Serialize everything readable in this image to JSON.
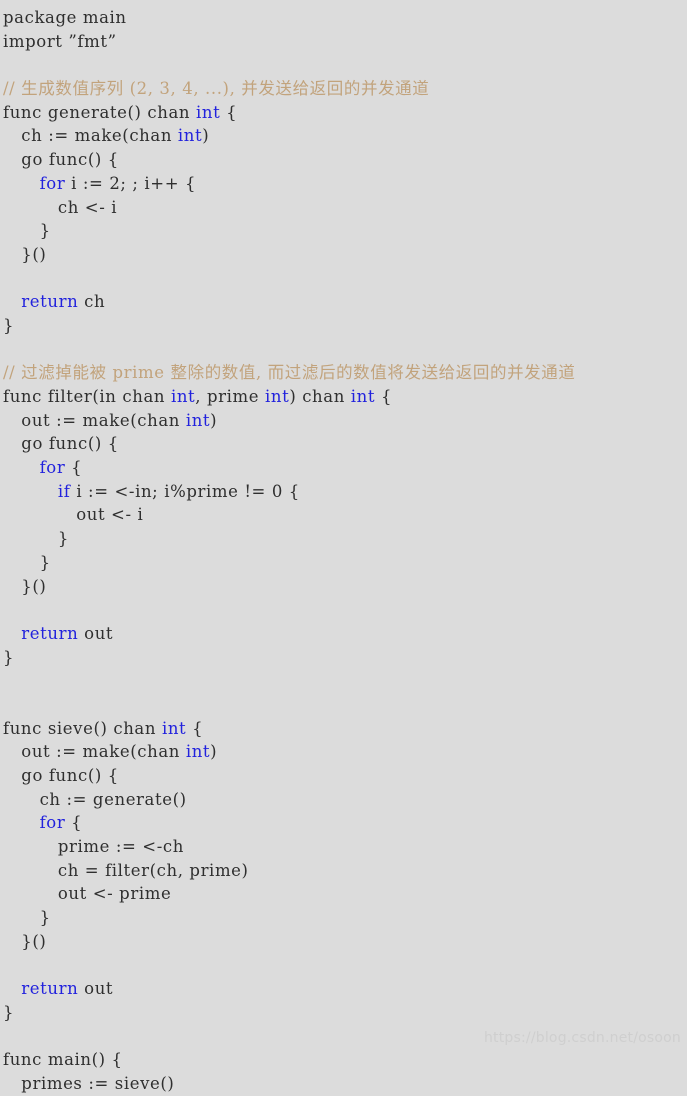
{
  "editor": {
    "language": "go",
    "background_color": "#dcdcdc",
    "text_color": "#2f2f2f",
    "keyword_color": "#2222dd",
    "comment_color": "#c2a37c",
    "watermark_color": "#cfcfcf"
  },
  "watermark": {
    "text": "https://blog.csdn.net/osoon"
  },
  "code": {
    "lines": [
      {
        "indent": 0,
        "tokens": [
          {
            "t": "plain",
            "s": "package main"
          }
        ]
      },
      {
        "indent": 0,
        "tokens": [
          {
            "t": "plain",
            "s": "import ”fmt”"
          }
        ]
      },
      {
        "indent": 0,
        "tokens": [
          {
            "t": "plain",
            "s": ""
          }
        ]
      },
      {
        "indent": 0,
        "tokens": [
          {
            "t": "comment",
            "s": "// 生成数值序列 (2, 3, 4, ...), 并发送给返回的并发通道"
          }
        ]
      },
      {
        "indent": 0,
        "tokens": [
          {
            "t": "plain",
            "s": "func generate() chan "
          },
          {
            "t": "kw",
            "s": "int"
          },
          {
            "t": "plain",
            "s": " {"
          }
        ]
      },
      {
        "indent": 1,
        "tokens": [
          {
            "t": "plain",
            "s": "ch := make(chan "
          },
          {
            "t": "kw",
            "s": "int"
          },
          {
            "t": "plain",
            "s": ")"
          }
        ]
      },
      {
        "indent": 1,
        "tokens": [
          {
            "t": "plain",
            "s": "go func() {"
          }
        ]
      },
      {
        "indent": 2,
        "tokens": [
          {
            "t": "kw",
            "s": "for"
          },
          {
            "t": "plain",
            "s": " i := 2; ; i++ {"
          }
        ]
      },
      {
        "indent": 3,
        "tokens": [
          {
            "t": "plain",
            "s": "ch <- i"
          }
        ]
      },
      {
        "indent": 2,
        "tokens": [
          {
            "t": "plain",
            "s": "}"
          }
        ]
      },
      {
        "indent": 1,
        "tokens": [
          {
            "t": "plain",
            "s": "}()"
          }
        ]
      },
      {
        "indent": 0,
        "tokens": [
          {
            "t": "plain",
            "s": ""
          }
        ]
      },
      {
        "indent": 1,
        "tokens": [
          {
            "t": "kw",
            "s": "return"
          },
          {
            "t": "plain",
            "s": " ch"
          }
        ]
      },
      {
        "indent": 0,
        "tokens": [
          {
            "t": "plain",
            "s": "}"
          }
        ]
      },
      {
        "indent": 0,
        "tokens": [
          {
            "t": "plain",
            "s": ""
          }
        ]
      },
      {
        "indent": 0,
        "tokens": [
          {
            "t": "comment",
            "s": "// 过滤掉能被 prime 整除的数值, 而过滤后的数值将发送给返回的并发通道"
          }
        ]
      },
      {
        "indent": 0,
        "tokens": [
          {
            "t": "plain",
            "s": "func filter(in chan "
          },
          {
            "t": "kw",
            "s": "int"
          },
          {
            "t": "plain",
            "s": ", prime "
          },
          {
            "t": "kw",
            "s": "int"
          },
          {
            "t": "plain",
            "s": ") chan "
          },
          {
            "t": "kw",
            "s": "int"
          },
          {
            "t": "plain",
            "s": " {"
          }
        ]
      },
      {
        "indent": 1,
        "tokens": [
          {
            "t": "plain",
            "s": "out := make(chan "
          },
          {
            "t": "kw",
            "s": "int"
          },
          {
            "t": "plain",
            "s": ")"
          }
        ]
      },
      {
        "indent": 1,
        "tokens": [
          {
            "t": "plain",
            "s": "go func() {"
          }
        ]
      },
      {
        "indent": 2,
        "tokens": [
          {
            "t": "kw",
            "s": "for"
          },
          {
            "t": "plain",
            "s": " {"
          }
        ]
      },
      {
        "indent": 3,
        "tokens": [
          {
            "t": "kw",
            "s": "if"
          },
          {
            "t": "plain",
            "s": " i := <-in; i%prime != 0 {"
          }
        ]
      },
      {
        "indent": 4,
        "tokens": [
          {
            "t": "plain",
            "s": "out <- i"
          }
        ]
      },
      {
        "indent": 3,
        "tokens": [
          {
            "t": "plain",
            "s": "}"
          }
        ]
      },
      {
        "indent": 2,
        "tokens": [
          {
            "t": "plain",
            "s": "}"
          }
        ]
      },
      {
        "indent": 1,
        "tokens": [
          {
            "t": "plain",
            "s": "}()"
          }
        ]
      },
      {
        "indent": 0,
        "tokens": [
          {
            "t": "plain",
            "s": ""
          }
        ]
      },
      {
        "indent": 1,
        "tokens": [
          {
            "t": "kw",
            "s": "return"
          },
          {
            "t": "plain",
            "s": " out"
          }
        ]
      },
      {
        "indent": 0,
        "tokens": [
          {
            "t": "plain",
            "s": "}"
          }
        ]
      },
      {
        "indent": 0,
        "tokens": [
          {
            "t": "plain",
            "s": ""
          }
        ]
      },
      {
        "indent": 0,
        "tokens": [
          {
            "t": "plain",
            "s": ""
          }
        ]
      },
      {
        "indent": 0,
        "tokens": [
          {
            "t": "plain",
            "s": "func sieve() chan "
          },
          {
            "t": "kw",
            "s": "int"
          },
          {
            "t": "plain",
            "s": " {"
          }
        ]
      },
      {
        "indent": 1,
        "tokens": [
          {
            "t": "plain",
            "s": "out := make(chan "
          },
          {
            "t": "kw",
            "s": "int"
          },
          {
            "t": "plain",
            "s": ")"
          }
        ]
      },
      {
        "indent": 1,
        "tokens": [
          {
            "t": "plain",
            "s": "go func() {"
          }
        ]
      },
      {
        "indent": 2,
        "tokens": [
          {
            "t": "plain",
            "s": "ch := generate()"
          }
        ]
      },
      {
        "indent": 2,
        "tokens": [
          {
            "t": "kw",
            "s": "for"
          },
          {
            "t": "plain",
            "s": " {"
          }
        ]
      },
      {
        "indent": 3,
        "tokens": [
          {
            "t": "plain",
            "s": "prime := <-ch"
          }
        ]
      },
      {
        "indent": 3,
        "tokens": [
          {
            "t": "plain",
            "s": "ch = filter(ch, prime)"
          }
        ]
      },
      {
        "indent": 3,
        "tokens": [
          {
            "t": "plain",
            "s": "out <- prime"
          }
        ]
      },
      {
        "indent": 2,
        "tokens": [
          {
            "t": "plain",
            "s": "}"
          }
        ]
      },
      {
        "indent": 1,
        "tokens": [
          {
            "t": "plain",
            "s": "}()"
          }
        ]
      },
      {
        "indent": 0,
        "tokens": [
          {
            "t": "plain",
            "s": ""
          }
        ]
      },
      {
        "indent": 1,
        "tokens": [
          {
            "t": "kw",
            "s": "return"
          },
          {
            "t": "plain",
            "s": " out"
          }
        ]
      },
      {
        "indent": 0,
        "tokens": [
          {
            "t": "plain",
            "s": "}"
          }
        ]
      },
      {
        "indent": 0,
        "tokens": [
          {
            "t": "plain",
            "s": ""
          }
        ]
      },
      {
        "indent": 0,
        "tokens": [
          {
            "t": "plain",
            "s": "func main() {"
          }
        ]
      },
      {
        "indent": 1,
        "tokens": [
          {
            "t": "plain",
            "s": "primes := sieve()"
          }
        ]
      }
    ]
  }
}
